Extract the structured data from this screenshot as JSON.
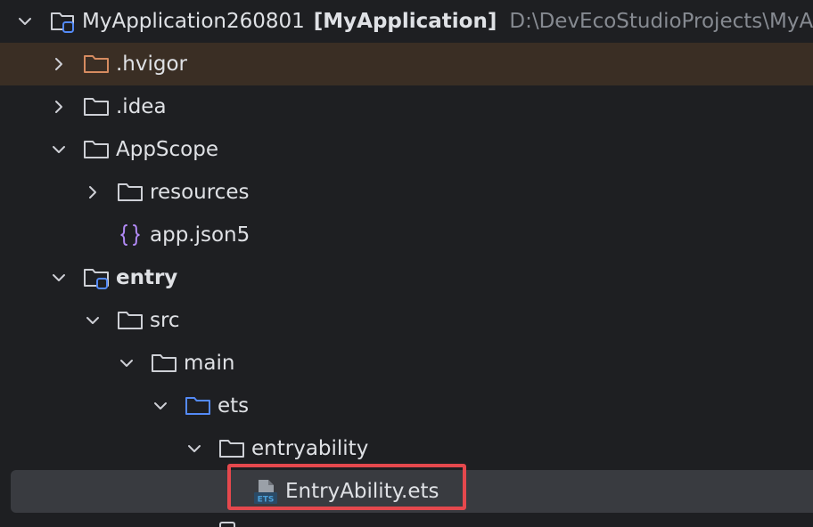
{
  "tree": {
    "root": {
      "name": "MyApplication260801",
      "module": "[MyApplication]",
      "path": "D:\\DevEcoStudioProjects\\MyAp"
    },
    "items": [
      {
        "label": ".hvigor",
        "state": "collapsed"
      },
      {
        "label": ".idea",
        "state": "collapsed"
      },
      {
        "label": "AppScope",
        "state": "expanded"
      },
      {
        "label": "resources",
        "state": "collapsed"
      },
      {
        "label": "app.json5",
        "type": "json-file"
      },
      {
        "label": "entry",
        "state": "expanded",
        "type": "module"
      },
      {
        "label": "src",
        "state": "expanded"
      },
      {
        "label": "main",
        "state": "expanded"
      },
      {
        "label": "ets",
        "state": "expanded",
        "type": "source-folder"
      },
      {
        "label": "entryability",
        "state": "expanded"
      },
      {
        "label": "EntryAbility.ets",
        "type": "ets-file",
        "selected": true,
        "highlighted": true
      }
    ]
  },
  "colors": {
    "background": "#1e1f22",
    "ignored_row": "#3a2e24",
    "selected_row": "#393b40",
    "text": "#dfe1e5",
    "path_text": "#868a91",
    "folder_icon": "#ced0d6",
    "ignored_folder_icon": "#d68b60",
    "source_folder_icon": "#548af7",
    "json_icon": "#b189f5",
    "ets_icon": "#4a9fd8",
    "highlight_box": "#e5484d"
  },
  "icons": {
    "chevron_down": "chevron-down-icon",
    "chevron_right": "chevron-right-icon",
    "folder": "folder-icon",
    "module_folder": "module-folder-icon",
    "json": "json-file-icon",
    "ets": "ets-file-icon",
    "ets_badge": "ETS"
  }
}
